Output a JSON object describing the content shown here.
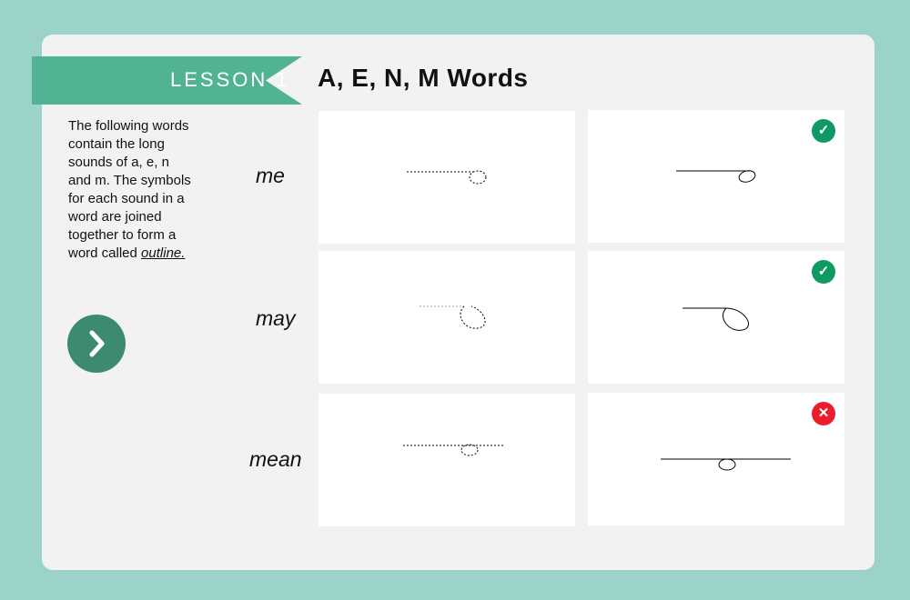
{
  "lesson": {
    "label": "LESSON 1",
    "title": "A, E, N, M Words"
  },
  "intro": {
    "text": "The following words contain the long sounds of a, e, n and m. The symbols for each sound in a word are joined together to form a word called",
    "link": "outline."
  },
  "colors": {
    "ribbon": "#52b394",
    "next": "#3d8a73",
    "correct": "#0f9a63",
    "wrong": "#ec1c2c"
  },
  "rows": [
    {
      "word": "me",
      "result": "correct",
      "icon": "check-icon",
      "glyph": "✓"
    },
    {
      "word": "may",
      "result": "correct",
      "icon": "check-icon",
      "glyph": "✓"
    },
    {
      "word": "mean",
      "result": "wrong",
      "icon": "cross-icon",
      "glyph": "✕"
    }
  ],
  "next_icon": "chevron-right-icon"
}
